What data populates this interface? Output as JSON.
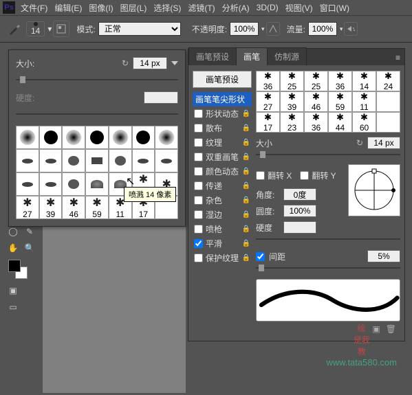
{
  "menu": {
    "items": [
      "文件(F)",
      "编辑(E)",
      "图像(I)",
      "图层(L)",
      "选择(S)",
      "滤镜(T)",
      "分析(A)",
      "3D(D)",
      "视图(V)",
      "窗口(W)"
    ]
  },
  "optbar": {
    "brush_size": "14",
    "mode_label": "模式:",
    "mode_value": "正常",
    "opacity_label": "不透明度:",
    "opacity_value": "100%",
    "flow_label": "流量:",
    "flow_value": "100%"
  },
  "popup": {
    "size_label": "大小:",
    "size_value": "14 px",
    "hardness_label": "硬度:",
    "hardness_value": "",
    "tooltip": "喷溅 14 像素",
    "grid_rows": [
      [
        {
          "t": "soft"
        },
        {
          "t": "circ"
        },
        {
          "t": "soft"
        },
        {
          "t": "circ"
        },
        {
          "t": "soft"
        },
        {
          "t": "circ"
        },
        {
          "t": "soft"
        }
      ],
      [
        {
          "t": "el"
        },
        {
          "t": "el"
        },
        {
          "t": "disc"
        },
        {
          "t": "flat"
        },
        {
          "t": "disc"
        },
        {
          "t": "el"
        },
        {
          "t": "el"
        }
      ],
      [
        {
          "t": "el"
        },
        {
          "t": "el"
        },
        {
          "t": "disc"
        },
        {
          "t": "fan"
        },
        {
          "t": "fan"
        },
        {
          "t": "spray",
          "n": "24"
        },
        {
          "t": "spray"
        }
      ],
      [
        {
          "t": "spray",
          "n": "27"
        },
        {
          "t": "spray",
          "n": "39"
        },
        {
          "t": "spray",
          "n": "46"
        },
        {
          "t": "spray",
          "n": "59"
        },
        {
          "t": "spray",
          "n": "11"
        },
        {
          "t": "spray",
          "n": "17"
        },
        {
          "t": ""
        }
      ]
    ]
  },
  "panel": {
    "tabs": [
      "画笔预设",
      "画笔",
      "仿制源"
    ],
    "active_tab": 1,
    "preset_btn": "画笔预设",
    "list": [
      {
        "label": "画笔笔尖形状",
        "cb": false,
        "hl": true,
        "lock": false
      },
      {
        "label": "形状动态",
        "cb": true,
        "checked": false,
        "lock": true
      },
      {
        "label": "散布",
        "cb": true,
        "checked": false,
        "lock": true
      },
      {
        "label": "纹理",
        "cb": true,
        "checked": false,
        "lock": true
      },
      {
        "label": "双重画笔",
        "cb": true,
        "checked": false,
        "lock": true
      },
      {
        "label": "颜色动态",
        "cb": true,
        "checked": false,
        "lock": true
      },
      {
        "label": "传递",
        "cb": true,
        "checked": false,
        "lock": true
      },
      {
        "label": "杂色",
        "cb": true,
        "checked": false,
        "lock": true
      },
      {
        "label": "湿边",
        "cb": true,
        "checked": false,
        "lock": true
      },
      {
        "label": "喷枪",
        "cb": true,
        "checked": false,
        "lock": true
      },
      {
        "label": "平滑",
        "cb": true,
        "checked": true,
        "lock": true
      },
      {
        "label": "保护纹理",
        "cb": true,
        "checked": false,
        "lock": true
      }
    ],
    "mini_grid": [
      [
        {
          "n": "36"
        },
        {
          "n": "25"
        },
        {
          "n": "25"
        },
        {
          "n": "36"
        },
        {
          "n": "14"
        },
        {
          "n": "24"
        }
      ],
      [
        {
          "n": "27"
        },
        {
          "n": "39"
        },
        {
          "n": "46"
        },
        {
          "n": "59"
        },
        {
          "n": "11"
        }
      ],
      [
        {
          "n": "17"
        },
        {
          "n": "23"
        },
        {
          "n": "36"
        },
        {
          "n": "44"
        },
        {
          "n": "60"
        }
      ]
    ],
    "size_label": "大小",
    "size_value": "14 px",
    "flipx_label": "翻转 X",
    "flipy_label": "翻转 Y",
    "angle_label": "角度:",
    "angle_value": "0度",
    "round_label": "圆度:",
    "round_value": "100%",
    "hardness_label": "硬度",
    "spacing_label": "间距",
    "spacing_value": "5%"
  },
  "watermark": {
    "line1": "绘",
    "line2": "是我",
    "line3": "教",
    "url": "www.tata580.com"
  }
}
